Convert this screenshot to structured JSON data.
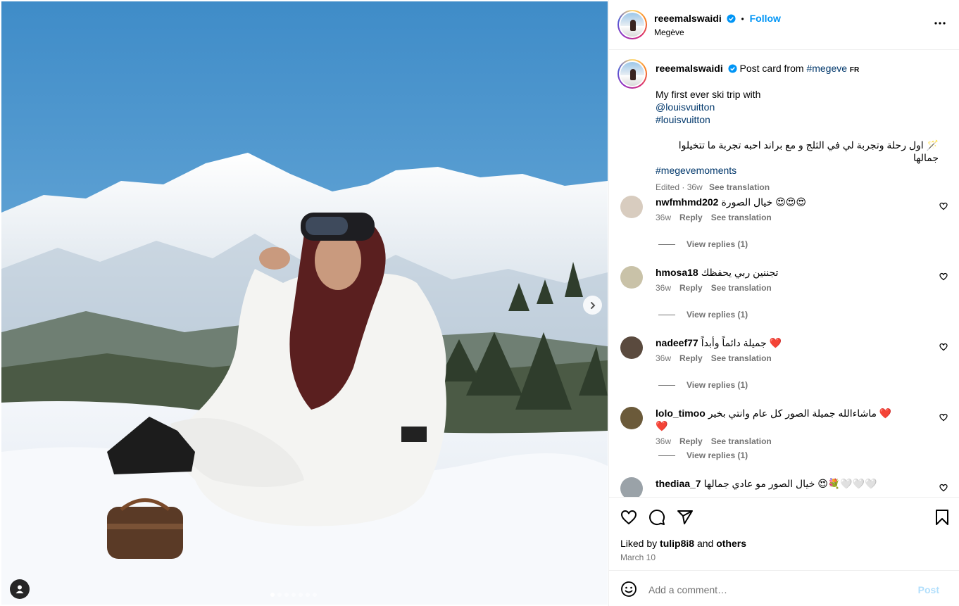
{
  "post": {
    "username": "reeemalswaidi",
    "follow_label": "Follow",
    "separator": "•",
    "location": "Megève"
  },
  "caption": {
    "username": "reeemalswaidi",
    "prefix": "Post card from",
    "hashtag_location": "#megeve",
    "lang": "FR",
    "line1": "My first ever ski trip with",
    "mention": "@louisvuitton",
    "hashtag1": "#louisvuitton",
    "arabic": "اول رحلة وتجربة لي في الثلج و مع براند احبه تجربة ما تتخيلوا جمالها",
    "arabic_emoji": "🪄",
    "hashtag2": "#megevemoments",
    "edited": "Edited · 36w",
    "see_translation": "See translation"
  },
  "comments": [
    {
      "username": "nwfmhmd202",
      "text": "خيال الصورة 😍😍😍",
      "time": "36w",
      "reply": "Reply",
      "translate": "See translation",
      "view_replies": "View replies (1)"
    },
    {
      "username": "hmosa18",
      "text": "تجننين ربي يحفظك",
      "time": "36w",
      "reply": "Reply",
      "translate": "See translation",
      "view_replies": "View replies (1)"
    },
    {
      "username": "nadeef77",
      "text": "جميلة دائماً وأبداً ❤️",
      "time": "36w",
      "reply": "Reply",
      "translate": "See translation",
      "view_replies": "View replies (1)"
    },
    {
      "username": "lolo_timoo",
      "text": "ماشاءالله جميلة الصور كل عام وانتي بخير ❤️❤️",
      "time": "36w",
      "reply": "Reply",
      "translate": "See translation",
      "view_replies": "View replies (1)"
    },
    {
      "username": "thediaa_7",
      "text": "خيال الصور مو عادي جمالها 😍💐🤍🤍🤍"
    }
  ],
  "footer": {
    "liked_by_prefix": "Liked by",
    "liked_by_user": "tulip8i8",
    "liked_by_and": "and",
    "liked_by_others": "others",
    "date": "March 10",
    "comment_placeholder": "Add a comment…",
    "post_label": "Post"
  },
  "carousel": {
    "slides": 7,
    "active": 0
  },
  "colors": {
    "accent": "#0095f6",
    "link": "#00376b",
    "muted": "#737373",
    "border": "#efefef",
    "post_disabled": "#b2dffc"
  },
  "icons": [
    "next-arrow-icon",
    "user-tag-icon",
    "more-options-icon",
    "verified-icon",
    "heart-icon",
    "comment-icon",
    "share-icon",
    "bookmark-icon",
    "emoji-icon"
  ]
}
